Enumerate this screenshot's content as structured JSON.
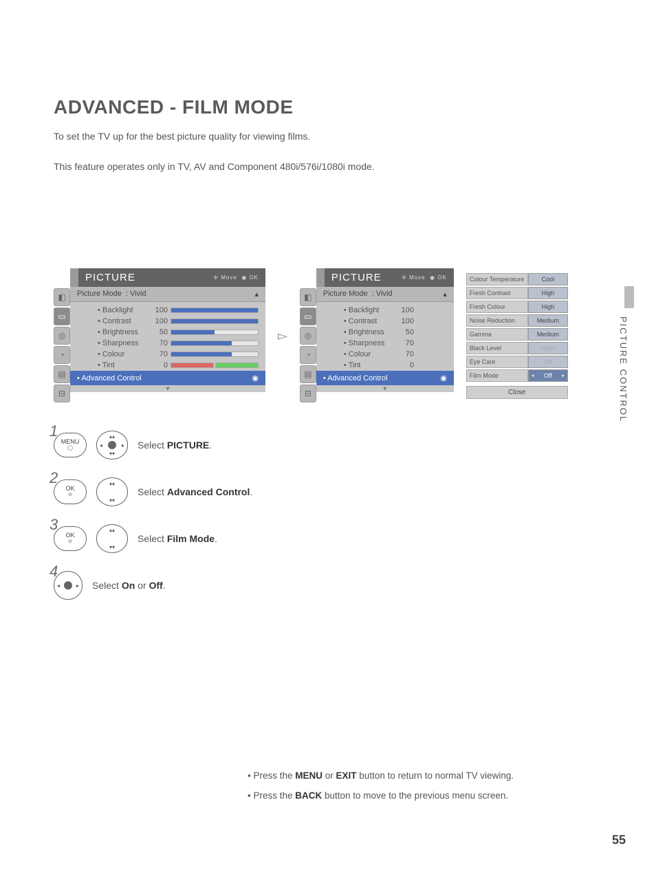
{
  "title": "ADVANCED - FILM MODE",
  "intro": "To set the TV up for the best picture quality for viewing films.",
  "intro2": "This feature operates only in TV, AV and Component 480i/576i/1080i mode.",
  "menu": {
    "heading": "PICTURE",
    "hints_move": "Move",
    "hints_ok": "OK",
    "mode_label": "Picture Mode",
    "mode_value": "Vivid",
    "rows": [
      {
        "label": "Backlight",
        "value": "100",
        "pct": 100
      },
      {
        "label": "Contrast",
        "value": "100",
        "pct": 100
      },
      {
        "label": "Brightness",
        "value": "50",
        "pct": 50
      },
      {
        "label": "Sharpness",
        "value": "70",
        "pct": 70
      },
      {
        "label": "Colour",
        "value": "70",
        "pct": 70
      },
      {
        "label": "Tint",
        "value": "0"
      }
    ],
    "advanced": "Advanced Control"
  },
  "popup": {
    "rows": [
      {
        "label": "Colour Temperature",
        "value": "Cool"
      },
      {
        "label": "Fresh Contrast",
        "value": "High"
      },
      {
        "label": "Fresh Colour",
        "value": "High"
      },
      {
        "label": "Noise Reduction",
        "value": "Medium"
      },
      {
        "label": "Gamma",
        "value": "Medium"
      },
      {
        "label": "Black Level",
        "value": "High",
        "disabled": true
      },
      {
        "label": "Eye Care",
        "value": "Off",
        "disabled": true
      },
      {
        "label": "Film Mode",
        "value": "Off",
        "selected": true
      }
    ],
    "close": "Close"
  },
  "steps": {
    "s1_btn": "MENU",
    "s1_pre": "Select ",
    "s1_bold": "PICTURE",
    "s1_post": ".",
    "s2_btn": "OK",
    "s2_pre": "Select ",
    "s2_bold": "Advanced Control",
    "s2_post": ".",
    "s3_btn": "OK",
    "s3_pre": "Select ",
    "s3_bold": "Film Mode",
    "s3_post": ".",
    "s4_pre": "Select ",
    "s4_b1": "On",
    "s4_mid": " or ",
    "s4_b2": "Off",
    "s4_post": "."
  },
  "notes": {
    "n1_pre": "• Press the ",
    "n1_b1": "MENU",
    "n1_mid": " or ",
    "n1_b2": "EXIT",
    "n1_post": " button to return to normal TV viewing.",
    "n2_pre": "• Press the ",
    "n2_b1": "BACK",
    "n2_post": " button to move to the previous menu screen."
  },
  "sidetab": "PICTURE CONTROL",
  "pagenum": "55"
}
